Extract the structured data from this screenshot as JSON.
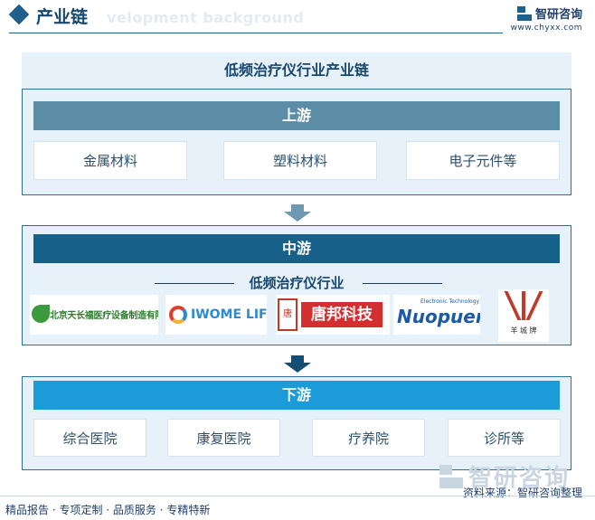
{
  "header": {
    "title": "产业链",
    "ghost_text": "velopment background"
  },
  "brand": {
    "name": "智研咨询",
    "url": "www.chyxx.com"
  },
  "diagram": {
    "title": "低频治疗仪行业产业链",
    "upstream": {
      "label": "上游",
      "items": [
        "金属材料",
        "塑料材料",
        "电子元件等"
      ]
    },
    "midstream": {
      "label": "中游",
      "subtitle": "低频治疗仪行业",
      "logos": {
        "tianchang": "北京天长福医疗设备制造有限公司",
        "iwome": "IWOME LIFE",
        "tangbang_seal": "唐邦",
        "tangbang": "唐邦科技",
        "nuopuen_small": "Electronic Technology",
        "nuopuen": "Nuopuen",
        "yangcheng": "羊 城 牌"
      }
    },
    "downstream": {
      "label": "下游",
      "items": [
        "综合医院",
        "康复医院",
        "疗养院",
        "诊所等"
      ]
    }
  },
  "footer": {
    "slogan": "精品报告 · 专项定制 · 品质服务 · 专精特新",
    "source": "资料来源：智研咨询整理",
    "watermark": "智研咨询"
  },
  "colors": {
    "upstream_header": "#5b8ea6",
    "midstream_header": "#17608a",
    "downstream_header": "#1b9bd8",
    "panel_bg": "#e7f1f9"
  }
}
